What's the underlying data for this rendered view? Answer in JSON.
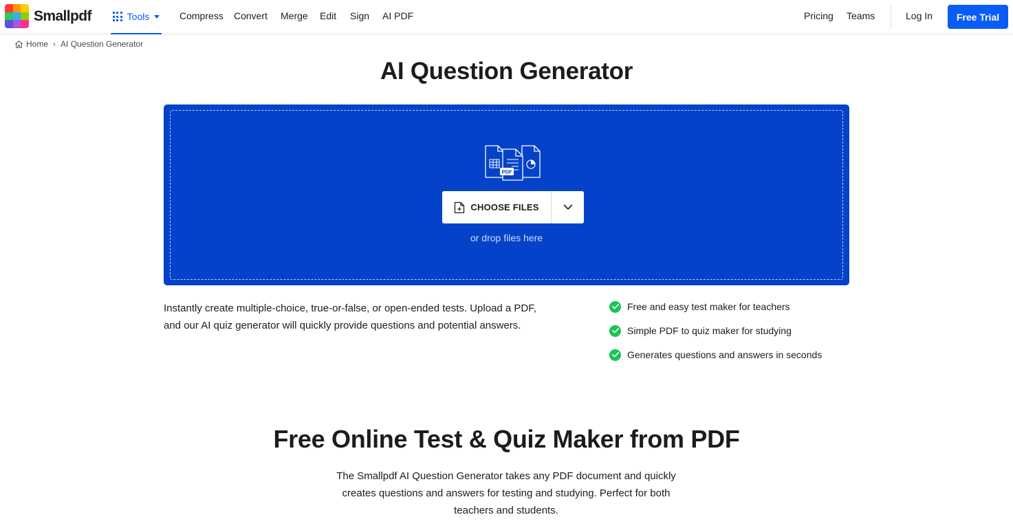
{
  "header": {
    "brand": "Smallpdf",
    "tools_label": "Tools",
    "nav": [
      "Compress",
      "Convert",
      "Merge",
      "Edit",
      "Sign",
      "AI PDF"
    ],
    "pricing": "Pricing",
    "teams": "Teams",
    "login": "Log In",
    "free_trial": "Free Trial"
  },
  "breadcrumb": {
    "home": "Home",
    "current": "AI Question Generator"
  },
  "page_title": "AI Question Generator",
  "dropzone": {
    "file_badge": "PDF",
    "choose_files": "CHOOSE FILES",
    "drop_hint": "or drop files here"
  },
  "intro": "Instantly create multiple-choice, true-or-false, or open-ended tests. Upload a PDF, and our AI quiz generator will quickly provide questions and potential answers.",
  "features": [
    "Free and easy test maker for teachers",
    "Simple PDF to quiz maker for studying",
    "Generates questions and answers in seconds"
  ],
  "section": {
    "title": "Free Online Test & Quiz Maker from PDF",
    "text": "The Smallpdf AI Question Generator takes any PDF document and quickly creates questions and answers for testing and studying. Perfect for both teachers and students."
  },
  "colors": {
    "accent": "#0a5cf5",
    "dropzone_bg": "#0443c9",
    "check": "#17c653"
  }
}
